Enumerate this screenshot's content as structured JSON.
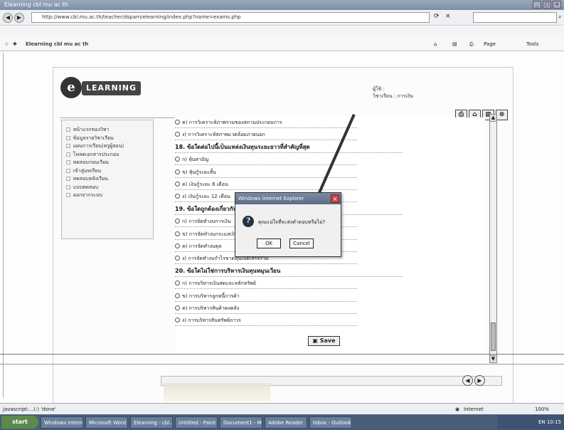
{
  "browser": {
    "url": "http://www.cbl.mu.ac.th/teacher/dsparn/elearning/index.php?name=exams.php",
    "search_placeholder": "",
    "tab_title": "Elearning cbl mu ac th",
    "status_left": "javascript:...(:) 'done'",
    "status_zone": "Internet",
    "status_zoom": "100%",
    "menu_items": [
      "Page",
      "Tools"
    ]
  },
  "site": {
    "logo_letter": "e",
    "logo_word": "LEARNING",
    "user_label": "ผู้ใช้ :",
    "user_sub": "วิชาเรียน : การเงิน"
  },
  "toolbar_icons": [
    "print-icon",
    "home-icon",
    "grid-icon",
    "close-icon"
  ],
  "sidebar": {
    "items": [
      "หน้าแรกของวิชา",
      "ข้อมูลรายวิชาเรียน",
      "แผนการเรียน(ครูผู้สอน)",
      "โหลดเอกสารประกอบ",
      "ทดสอบก่อนเรียน",
      "เข้าสู่บทเรียน",
      "ทดสอบหลังเรียน",
      "แบบทดสอบ",
      "ออกจากระบบ"
    ]
  },
  "questions": {
    "lines": [
      {
        "type": "a",
        "text": "ค) การวิเคราะห์ภาพรวมของสถานประกอบการ"
      },
      {
        "type": "a",
        "text": "ง) การวิเคราะห์สภาพแวดล้อมภายนอก"
      },
      {
        "type": "q",
        "text": "18. ข้อใดต่อไปนี้เป็นแหล่งเงินทุนระยะยาวที่สำคัญที่สุด"
      },
      {
        "type": "a",
        "text": "ก) หุ้นสามัญ"
      },
      {
        "type": "a",
        "text": "ข) หุ้นกู้ระยะสั้น"
      },
      {
        "type": "a",
        "text": "ค) เงินกู้ระยะ 6 เดือน"
      },
      {
        "type": "a",
        "text": "ง) เงินกู้ระยะ 12 เดือน"
      },
      {
        "type": "q",
        "text": "19. ข้อใดถูกต้องเกี่ยวกับ"
      },
      {
        "type": "a",
        "text": "ก) การจัดทำงบการเงิน"
      },
      {
        "type": "a",
        "text": "ข) การจัดทำงบกระแสเงินสด"
      },
      {
        "type": "a",
        "text": "ค) การจัดทำงบดุล"
      },
      {
        "type": "a",
        "text": "ง) การจัดทำงบกำไรขาดทุนเบ็ดเสร็จรวม"
      },
      {
        "type": "q",
        "text": "20. ข้อใดไม่ใช่การบริหารเงินทุนหมุนเวียน"
      },
      {
        "type": "a",
        "text": "ก) การบริหารเงินสดและหลักทรัพย์"
      },
      {
        "type": "a",
        "text": "ข) การบริหารลูกหนี้การค้า"
      },
      {
        "type": "a",
        "text": "ค) การบริหารสินค้าคงคลัง"
      },
      {
        "type": "a",
        "text": "ง) การบริหารสินทรัพย์ถาวร"
      }
    ],
    "save_label": "Save"
  },
  "dialog": {
    "title": "Windows Internet Explorer",
    "message": "คุณแน่ใจที่จะส่งคำตอบหรือไม่?",
    "ok_label": "OK",
    "cancel_label": "Cancel"
  },
  "taskbar": {
    "start_label": "start",
    "tasks": [
      "Windows Intern...",
      "Microsoft Word",
      "Elearning - cbl...",
      "Untitled - Paint",
      "Document1 - M...",
      "Adobe Reader",
      "Inbox - Outlook"
    ],
    "clock": "EN 10:15"
  }
}
